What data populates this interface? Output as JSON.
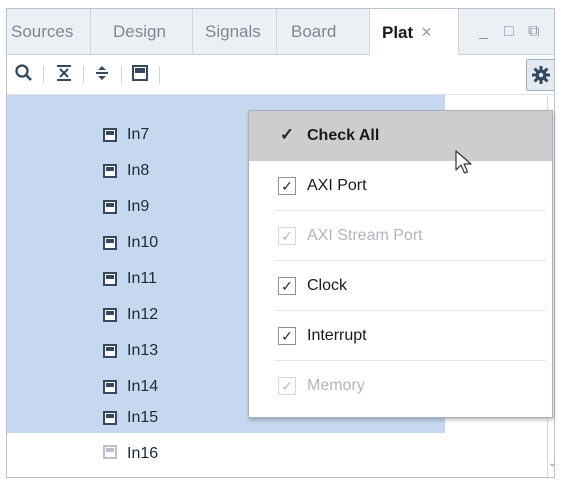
{
  "tabs": [
    {
      "label": "Sources"
    },
    {
      "label": "Design"
    },
    {
      "label": "Signals"
    },
    {
      "label": "Board"
    },
    {
      "label": "Plat",
      "close": "×",
      "active": true
    }
  ],
  "window_controls": {
    "minimize": "_",
    "restore": "□",
    "float": "⧉"
  },
  "toolbar": {
    "icons": [
      "search-icon",
      "collapse-all-icon",
      "expand-all-icon",
      "port-icon",
      "gear-icon"
    ]
  },
  "tree": {
    "items": [
      {
        "label": "In7",
        "selected": true
      },
      {
        "label": "In8",
        "selected": true
      },
      {
        "label": "In9",
        "selected": true
      },
      {
        "label": "In10",
        "selected": true
      },
      {
        "label": "In11",
        "selected": true
      },
      {
        "label": "In12",
        "selected": true
      },
      {
        "label": "In13",
        "selected": true
      },
      {
        "label": "In14",
        "selected": true
      },
      {
        "label": "In15",
        "selected": true
      },
      {
        "label": "In16",
        "selected": false
      }
    ]
  },
  "menu": {
    "items": [
      {
        "label": "Check All",
        "checked": true,
        "enabled": true,
        "highlighted": true
      },
      {
        "label": "AXI Port",
        "checked": true,
        "enabled": true
      },
      {
        "label": "AXI Stream Port",
        "checked": true,
        "enabled": false
      },
      {
        "label": "Clock",
        "checked": true,
        "enabled": true
      },
      {
        "label": "Interrupt",
        "checked": true,
        "enabled": true
      },
      {
        "label": "Memory",
        "checked": true,
        "enabled": false
      }
    ],
    "check_glyph": "✓"
  },
  "colors": {
    "selection": "#c5d8ef",
    "menu_highlight": "#cdcdcd",
    "tabbar_bg": "#eceff3"
  }
}
